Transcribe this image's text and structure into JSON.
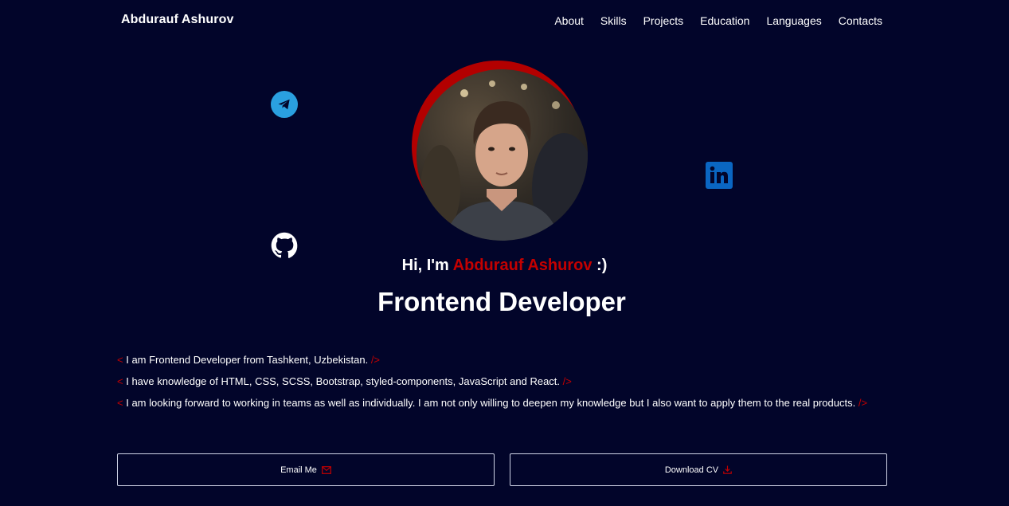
{
  "header": {
    "brand": "Abdurauf Ashurov",
    "nav": [
      "About",
      "Skills",
      "Projects",
      "Education",
      "Languages",
      "Contacts"
    ]
  },
  "social": {
    "telegram_icon": "telegram-icon",
    "linkedin_icon": "linkedin-icon",
    "github_icon": "github-icon"
  },
  "hero": {
    "greeting_prefix": "Hi, I'm ",
    "greeting_name": "Abdurauf Ashurov",
    "greeting_suffix": " :)",
    "role": "Frontend Developer"
  },
  "bio": {
    "open_tag": "<",
    "close_tag": "/>",
    "lines": [
      "I am Frontend Developer from Tashkent, Uzbekistan.",
      "I have knowledge of HTML, CSS, SCSS, Bootstrap, styled-components, JavaScript and React.",
      "I am looking forward to working in teams as well as individually. I am not only willing to deepen my knowledge but I also want to apply them to the real products."
    ]
  },
  "actions": {
    "email_label": "Email Me",
    "cv_label": "Download CV"
  },
  "colors": {
    "background": "#02052a",
    "accent": "#c40000",
    "text": "#ffffff"
  }
}
